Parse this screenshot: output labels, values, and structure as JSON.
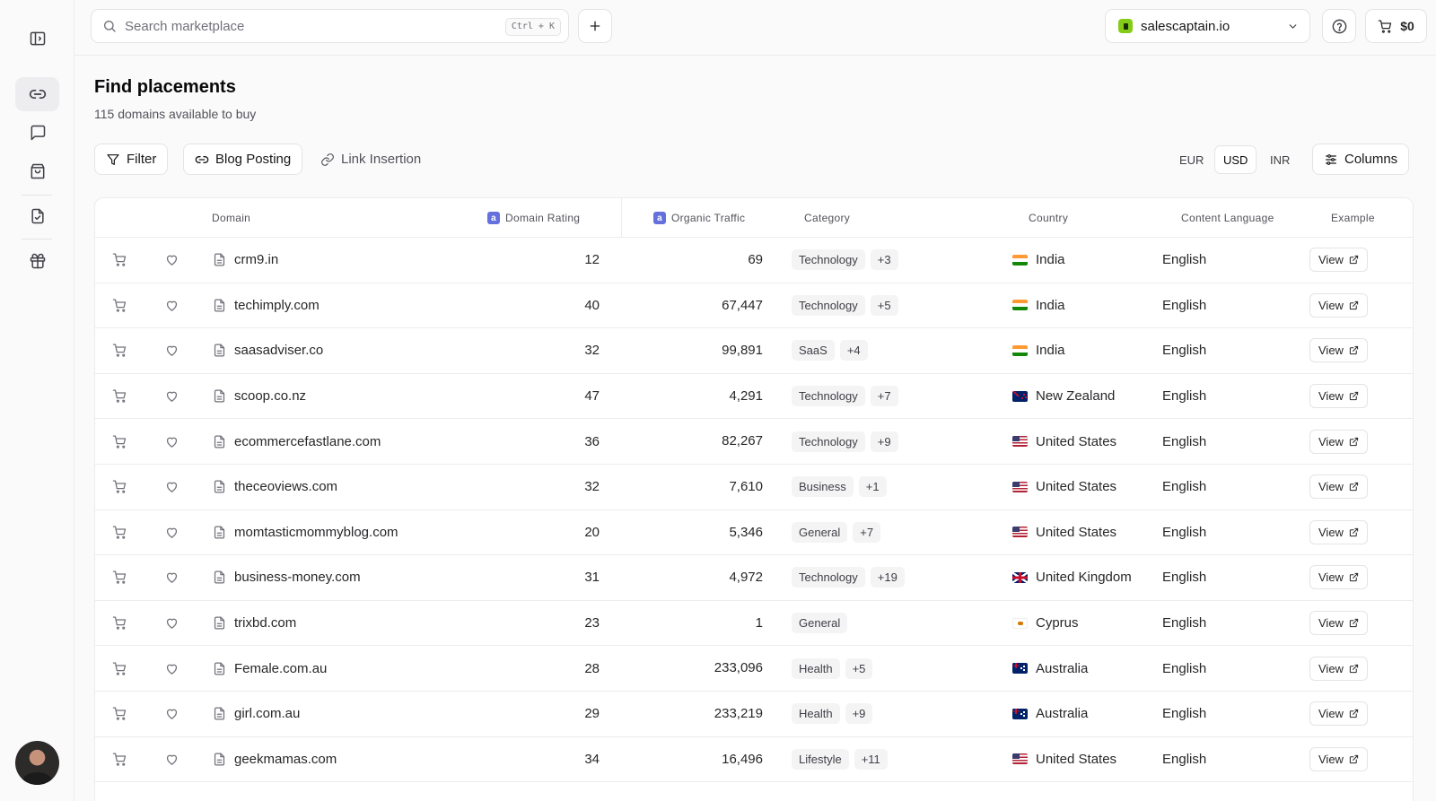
{
  "search": {
    "placeholder": "Search marketplace",
    "shortcut": "Ctrl + K"
  },
  "workspace": {
    "name": "salescaptain.io"
  },
  "cart": {
    "total": "$0"
  },
  "page": {
    "title": "Find placements",
    "subtitle": "115 domains available to buy"
  },
  "toolbar": {
    "filter_label": "Filter",
    "blog_posting_label": "Blog Posting",
    "link_insertion_label": "Link Insertion",
    "currencies": [
      "EUR",
      "USD",
      "INR"
    ],
    "active_currency": "USD",
    "columns_label": "Columns"
  },
  "table": {
    "headers": {
      "domain": "Domain",
      "domain_rating": "Domain Rating",
      "organic_traffic": "Organic Traffic",
      "category": "Category",
      "country": "Country",
      "content_language": "Content Language",
      "example": "Example"
    },
    "metric_badge": "a",
    "view_label": "View",
    "rows": [
      {
        "domain": "crm9.in",
        "dr": "12",
        "traffic": "69",
        "category": "Technology",
        "more": "+3",
        "country": "India",
        "flag": "india",
        "language": "English"
      },
      {
        "domain": "techimply.com",
        "dr": "40",
        "traffic": "67,447",
        "category": "Technology",
        "more": "+5",
        "country": "India",
        "flag": "india",
        "language": "English"
      },
      {
        "domain": "saasadviser.co",
        "dr": "32",
        "traffic": "99,891",
        "category": "SaaS",
        "more": "+4",
        "country": "India",
        "flag": "india",
        "language": "English"
      },
      {
        "domain": "scoop.co.nz",
        "dr": "47",
        "traffic": "4,291",
        "category": "Technology",
        "more": "+7",
        "country": "New Zealand",
        "flag": "nz",
        "language": "English"
      },
      {
        "domain": "ecommercefastlane.com",
        "dr": "36",
        "traffic": "82,267",
        "category": "Technology",
        "more": "+9",
        "country": "United States",
        "flag": "us",
        "language": "English"
      },
      {
        "domain": "theceoviews.com",
        "dr": "32",
        "traffic": "7,610",
        "category": "Business",
        "more": "+1",
        "country": "United States",
        "flag": "us",
        "language": "English"
      },
      {
        "domain": "momtasticmommyblog.com",
        "dr": "20",
        "traffic": "5,346",
        "category": "General",
        "more": "+7",
        "country": "United States",
        "flag": "us",
        "language": "English"
      },
      {
        "domain": "business-money.com",
        "dr": "31",
        "traffic": "4,972",
        "category": "Technology",
        "more": "+19",
        "country": "United Kingdom",
        "flag": "uk",
        "language": "English"
      },
      {
        "domain": "trixbd.com",
        "dr": "23",
        "traffic": "1",
        "category": "General",
        "more": "",
        "country": "Cyprus",
        "flag": "cy",
        "language": "English"
      },
      {
        "domain": "Female.com.au",
        "dr": "28",
        "traffic": "233,096",
        "category": "Health",
        "more": "+5",
        "country": "Australia",
        "flag": "au",
        "language": "English"
      },
      {
        "domain": "girl.com.au",
        "dr": "29",
        "traffic": "233,219",
        "category": "Health",
        "more": "+9",
        "country": "Australia",
        "flag": "au",
        "language": "English"
      },
      {
        "domain": "geekmamas.com",
        "dr": "34",
        "traffic": "16,496",
        "category": "Lifestyle",
        "more": "+11",
        "country": "United States",
        "flag": "us",
        "language": "English"
      }
    ]
  }
}
